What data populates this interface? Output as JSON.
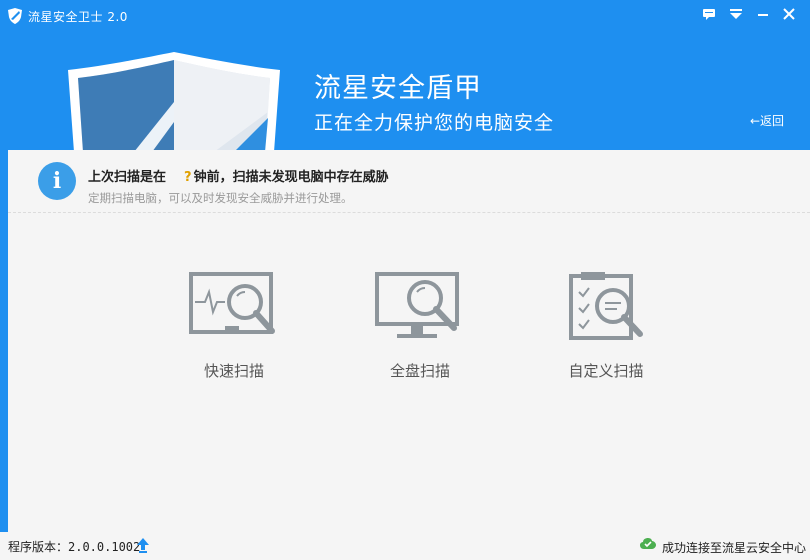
{
  "app": {
    "title": "流星安全卫士 2.0"
  },
  "window_buttons": [
    "menu-icon",
    "dropdown-icon",
    "minimize-icon",
    "close-icon"
  ],
  "hero": {
    "title": "流星安全盾甲",
    "subtitle": "正在全力保护您的电脑安全",
    "back_label": "←返回"
  },
  "info": {
    "icon": "i",
    "line1_prefix": "上次扫描是在",
    "line1_unknown": "?",
    "line1_suffix": "钟前，扫描未发现电脑中存在威胁",
    "line2": "定期扫描电脑，可以及时发现安全威胁并进行处理。"
  },
  "scan_options": [
    {
      "label": "快速扫描",
      "icon": "quick-scan-icon"
    },
    {
      "label": "全盘扫描",
      "icon": "full-scan-icon"
    },
    {
      "label": "自定义扫描",
      "icon": "custom-scan-icon"
    }
  ],
  "status": {
    "version": "程序版本：2.0.0.1002",
    "cloud": "成功连接至流星云安全中心"
  },
  "colors": {
    "brand_blue": "#1e8ff0",
    "content_bg": "#f5f5f5",
    "icon_gray": "#8e969c",
    "info_blue": "#3b9ee8",
    "warn_yellow": "#e0a000",
    "ok_green": "#4caf50"
  }
}
